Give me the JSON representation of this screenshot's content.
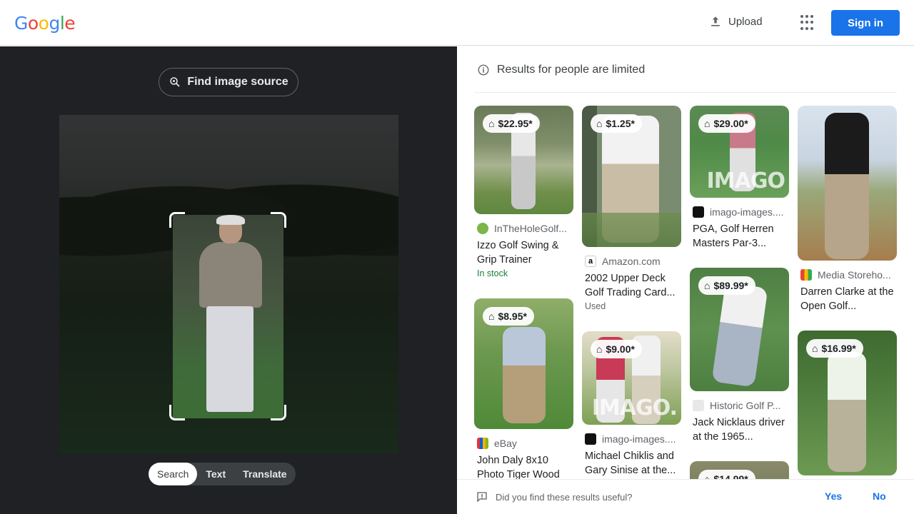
{
  "header": {
    "logo_letters": [
      "G",
      "o",
      "o",
      "g",
      "l",
      "e"
    ],
    "upload_label": "Upload",
    "signin_label": "Sign in"
  },
  "lens": {
    "find_source_label": "Find image source",
    "modes": [
      "Search",
      "Text",
      "Translate"
    ],
    "active_mode": "Search"
  },
  "results": {
    "notice": "Results for people are limited",
    "cards": [
      {
        "price": "$22.95*",
        "source": "InTheHoleGolf...",
        "title": "Izzo Golf Swing & Grip Trainer",
        "status": "In stock"
      },
      {
        "price": "$8.95*",
        "source": "eBay",
        "title": "John Daly 8x10 Photo Tiger Wood",
        "status": ""
      },
      {
        "price": "$1.25*",
        "source": "Amazon.com",
        "title": "2002 Upper Deck Golf Trading Card...",
        "status": "Used"
      },
      {
        "price": "$9.00*",
        "source": "imago-images....",
        "title": "Michael Chiklis and Gary Sinise at the...",
        "status": "",
        "watermark": "IMAGO."
      },
      {
        "price": "$29.00*",
        "source": "imago-images....",
        "title": "PGA, Golf Herren Masters Par-3...",
        "status": "",
        "watermark": "IMAGO"
      },
      {
        "price": "$89.99*",
        "source": "Historic Golf P...",
        "title": "Jack Nicklaus driver at the 1965...",
        "status": ""
      },
      {
        "price": "$14.99*",
        "source": "",
        "title": "",
        "status": ""
      },
      {
        "price": "",
        "source": "Media Storeho...",
        "title": "Darren Clarke at the Open Golf...",
        "status": ""
      },
      {
        "price": "$16.99*",
        "source": "",
        "title": "",
        "status": ""
      }
    ]
  },
  "feedback": {
    "question": "Did you find these results useful?",
    "yes": "Yes",
    "no": "No"
  },
  "colors": {
    "accent": "#1a73e8",
    "in_stock": "#188038",
    "dark_panel": "#202124"
  }
}
